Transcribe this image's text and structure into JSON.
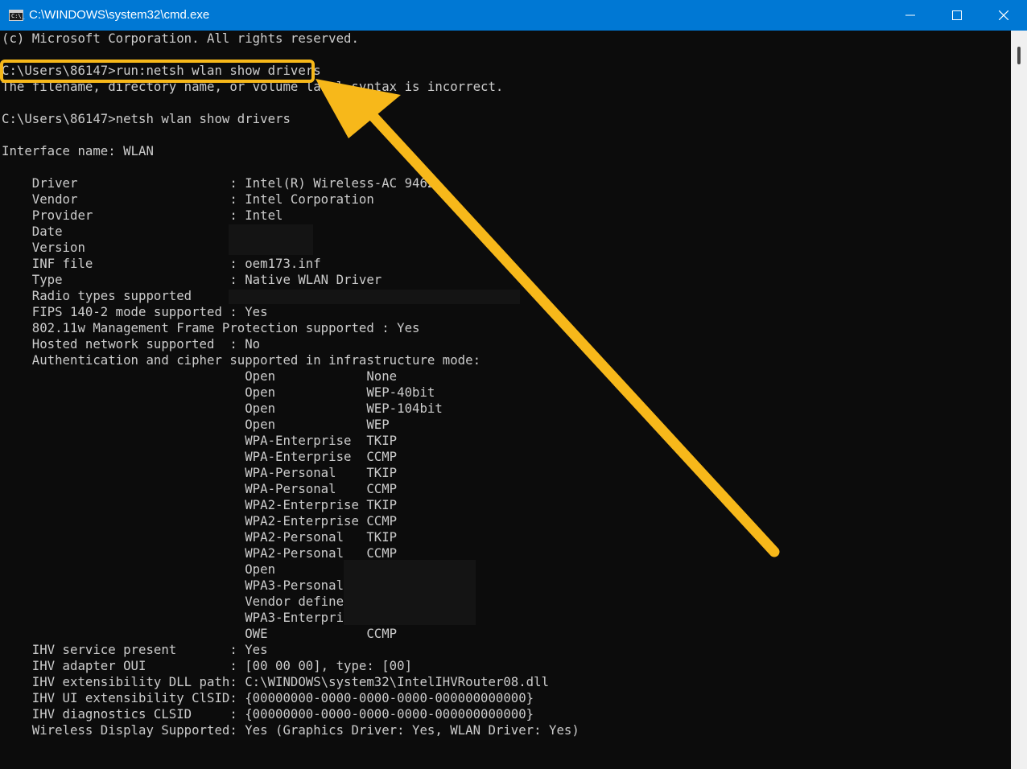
{
  "window": {
    "title": "C:\\WINDOWS\\system32\\cmd.exe",
    "icon_text": "C:\\_",
    "minimize_icon": "minimize-icon",
    "maximize_icon": "maximize-icon",
    "close_icon": "close-icon",
    "titlebar_color": "#0078d4"
  },
  "console": {
    "lines": [
      "(c) Microsoft Corporation. All rights reserved.",
      "",
      "C:\\Users\\86147>run:netsh wlan show drivers",
      "The filename, directory name, or volume label syntax is incorrect.",
      "",
      "C:\\Users\\86147>netsh wlan show drivers",
      "",
      "Interface name: WLAN",
      "",
      "    Driver                    : Intel(R) Wireless-AC 9462",
      "    Vendor                    : Intel Corporation",
      "    Provider                  : Intel",
      "    Date                      :",
      "    Version                   :",
      "    INF file                  : oem173.inf",
      "    Type                      : Native WLAN Driver",
      "    Radio types supported     :",
      "    FIPS 140-2 mode supported : Yes",
      "    802.11w Management Frame Protection supported : Yes",
      "    Hosted network supported  : No",
      "    Authentication and cipher supported in infrastructure mode:",
      "                                Open            None",
      "                                Open            WEP-40bit",
      "                                Open            WEP-104bit",
      "                                Open            WEP",
      "                                WPA-Enterprise  TKIP",
      "                                WPA-Enterprise  CCMP",
      "                                WPA-Personal    TKIP",
      "                                WPA-Personal    CCMP",
      "                                WPA2-Enterprise TKIP",
      "                                WPA2-Enterprise CCMP",
      "                                WPA2-Personal   TKIP",
      "                                WPA2-Personal   CCMP",
      "                                Open",
      "                                WPA3-Personal",
      "                                Vendor defined",
      "                                WPA3-Enterprise",
      "                                OWE             CCMP",
      "    IHV service present       : Yes",
      "    IHV adapter OUI           : [00 00 00], type: [00]",
      "    IHV extensibility DLL path: C:\\WINDOWS\\system32\\IntelIHVRouter08.dll",
      "    IHV UI extensibility ClSID: {00000000-0000-0000-0000-000000000000}",
      "    IHV diagnostics CLSID     : {00000000-0000-0000-0000-000000000000}",
      "    Wireless Display Supported: Yes (Graphics Driver: Yes, WLAN Driver: Yes)"
    ],
    "text_color": "#cccccc",
    "background": "#0c0c0c"
  },
  "annotation": {
    "highlight_color": "#f7b81a",
    "arrow_color": "#f7b81a"
  }
}
